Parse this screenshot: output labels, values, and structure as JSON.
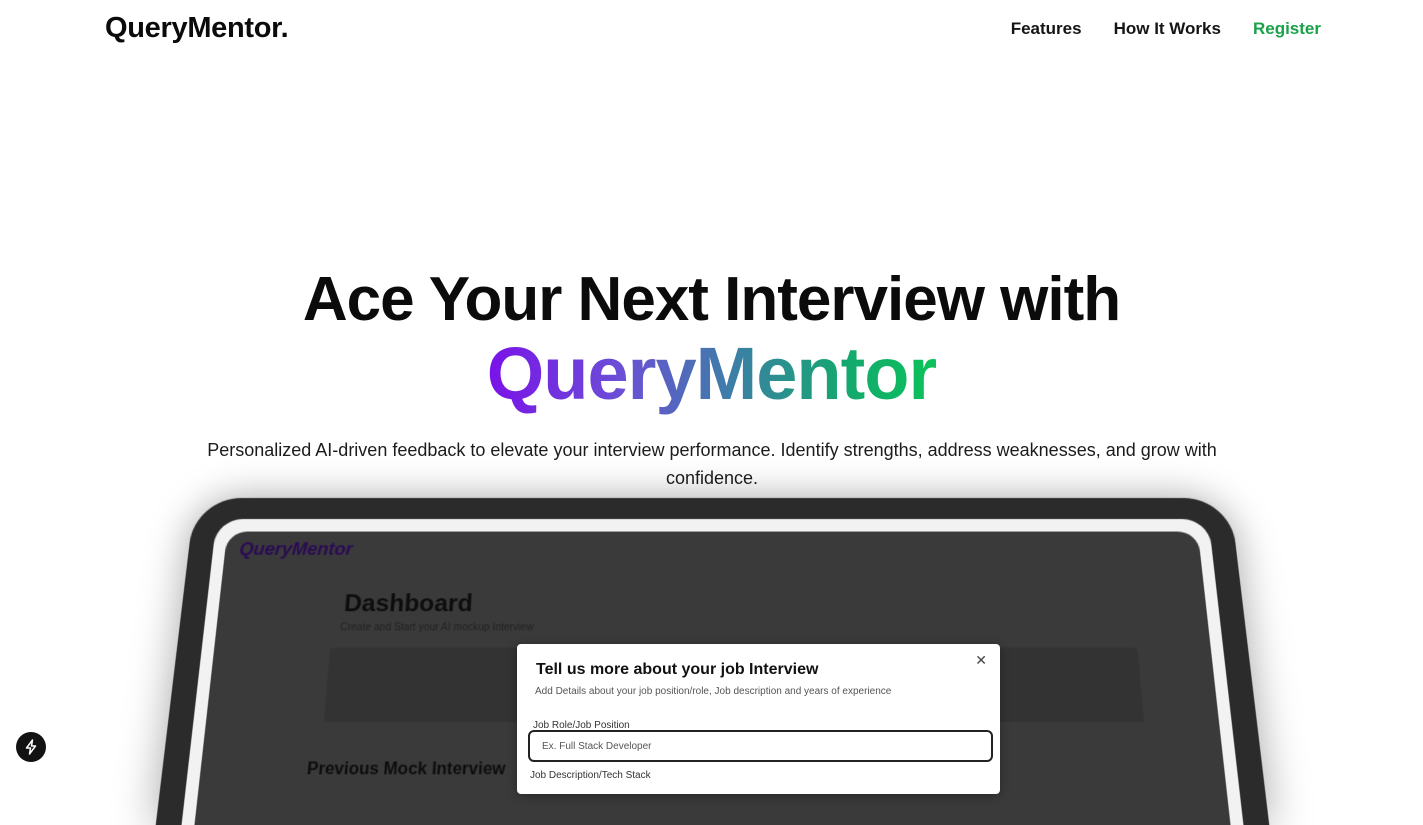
{
  "brand": {
    "logo_text": "QueryMentor."
  },
  "nav": {
    "links": [
      {
        "label": "Features"
      },
      {
        "label": "How It Works"
      },
      {
        "label": "Register"
      }
    ],
    "accent_color": "#1aa14a"
  },
  "hero": {
    "title_line1": "Ace Your Next Interview with",
    "title_brand": "QueryMentor",
    "brand_gradient": [
      "#7a12e8",
      "#3c7fa6",
      "#0cc25a"
    ],
    "subtitle": "Personalized AI-driven feedback to elevate your interview performance. Identify strengths, address weaknesses, and grow with confidence."
  },
  "mockup": {
    "app_logo": "QueryMentor",
    "dashboard_title": "Dashboard",
    "dashboard_subtitle": "Create and Start your AI mockup Interview",
    "previous_title": "Previous Mock Interview",
    "modal": {
      "title": "Tell us more about your job Interview",
      "subtitle": "Add Details about your job position/role, Job description and years of experience",
      "field1_label": "Job Role/Job Position",
      "field1_placeholder": "Ex. Full Stack Developer",
      "field2_label": "Job Description/Tech Stack",
      "close_icon": "close-icon"
    }
  },
  "floating_button": {
    "icon": "bolt-icon"
  }
}
